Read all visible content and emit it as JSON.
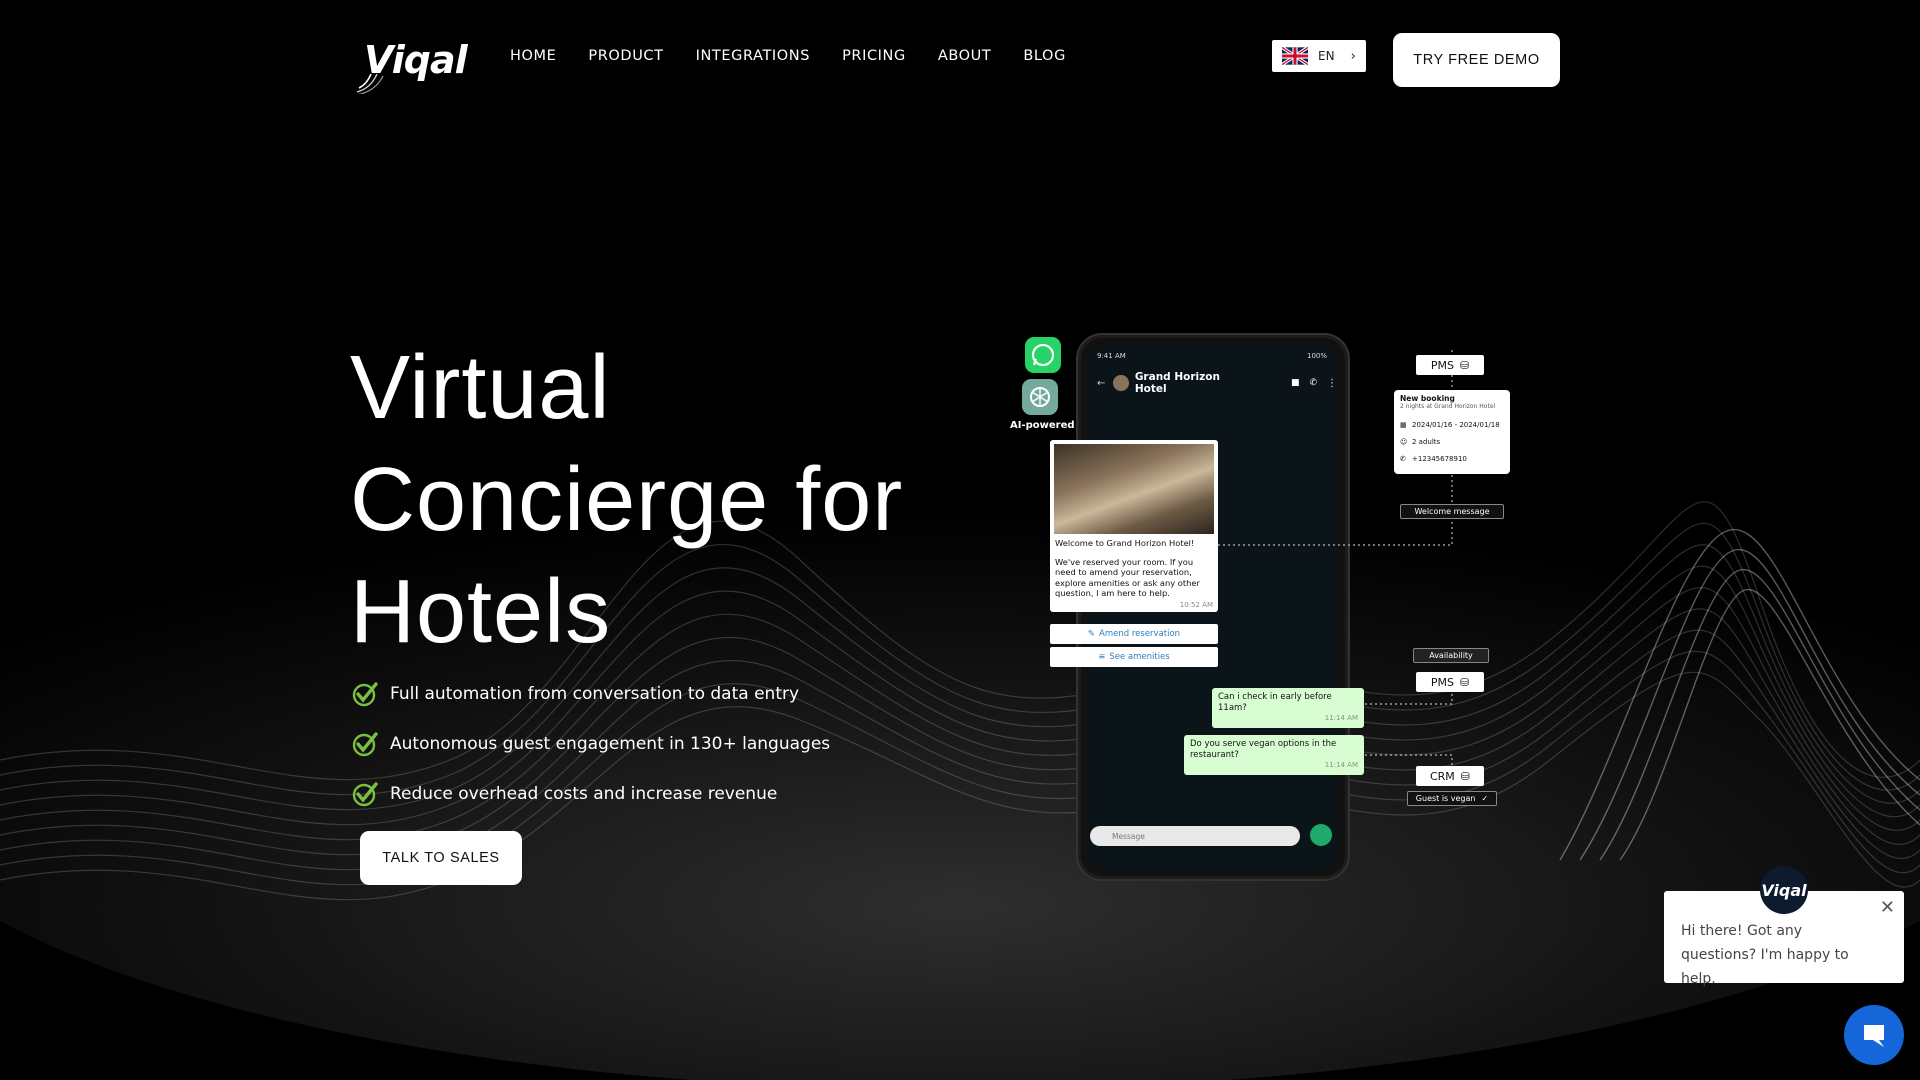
{
  "header": {
    "logo_text": "Viqal",
    "nav": [
      "HOME",
      "PRODUCT",
      "INTEGRATIONS",
      "PRICING",
      "ABOUT",
      "BLOG"
    ],
    "language": {
      "code": "EN",
      "flag_icon": "uk-flag-icon"
    },
    "cta_label": "TRY FREE DEMO"
  },
  "hero": {
    "title_lines": [
      "Virtual",
      "Concierge for",
      "Hotels"
    ],
    "bullets": [
      "Full automation from conversation to data entry",
      "Autonomous guest engagement in 130+ languages",
      "Reduce overhead costs and increase revenue"
    ],
    "cta_label": "TALK TO SALES"
  },
  "illustration": {
    "ai_label": "AI-powered",
    "phone": {
      "time": "9:41 AM",
      "battery": "100%",
      "chat_name": "Grand Horizon Hotel",
      "card_title": "Welcome to Grand Horizon Hotel!",
      "card_body": "We've reserved your room. If you need to amend your reservation, explore amenities or ask any other question, I am here to help.",
      "card_time": "10:52 AM",
      "button_amend": "Amend reservation",
      "button_amenities": "See amenities",
      "msg1": "Can i check in early before 11am?",
      "msg1_time": "11:14 AM",
      "msg2": "Do you serve vegan options in the restaurant?",
      "msg2_time": "11:14 AM",
      "input_placeholder": "Message"
    },
    "tags": {
      "pms_top": "PMS",
      "welcome": "Welcome message",
      "availability": "Availability",
      "pms_mid": "PMS",
      "crm": "CRM",
      "vegan": "Guest is vegan"
    },
    "booking": {
      "title": "New booking",
      "subtitle": "2 nights at Grand Horizon Hotel",
      "dates": "2024/01/16 - 2024/01/18",
      "guests": "2 adults",
      "phone": "+12345678910"
    }
  },
  "chat_widget": {
    "avatar_text": "Viqal",
    "message": "Hi there! Got any questions? I'm happy to help."
  },
  "colors": {
    "background": "#000000",
    "check_green": "#7ac142",
    "whatsapp_green": "#25d366",
    "chat_bubble": "#d9fdd3",
    "launcher_blue": "#1566d8"
  }
}
